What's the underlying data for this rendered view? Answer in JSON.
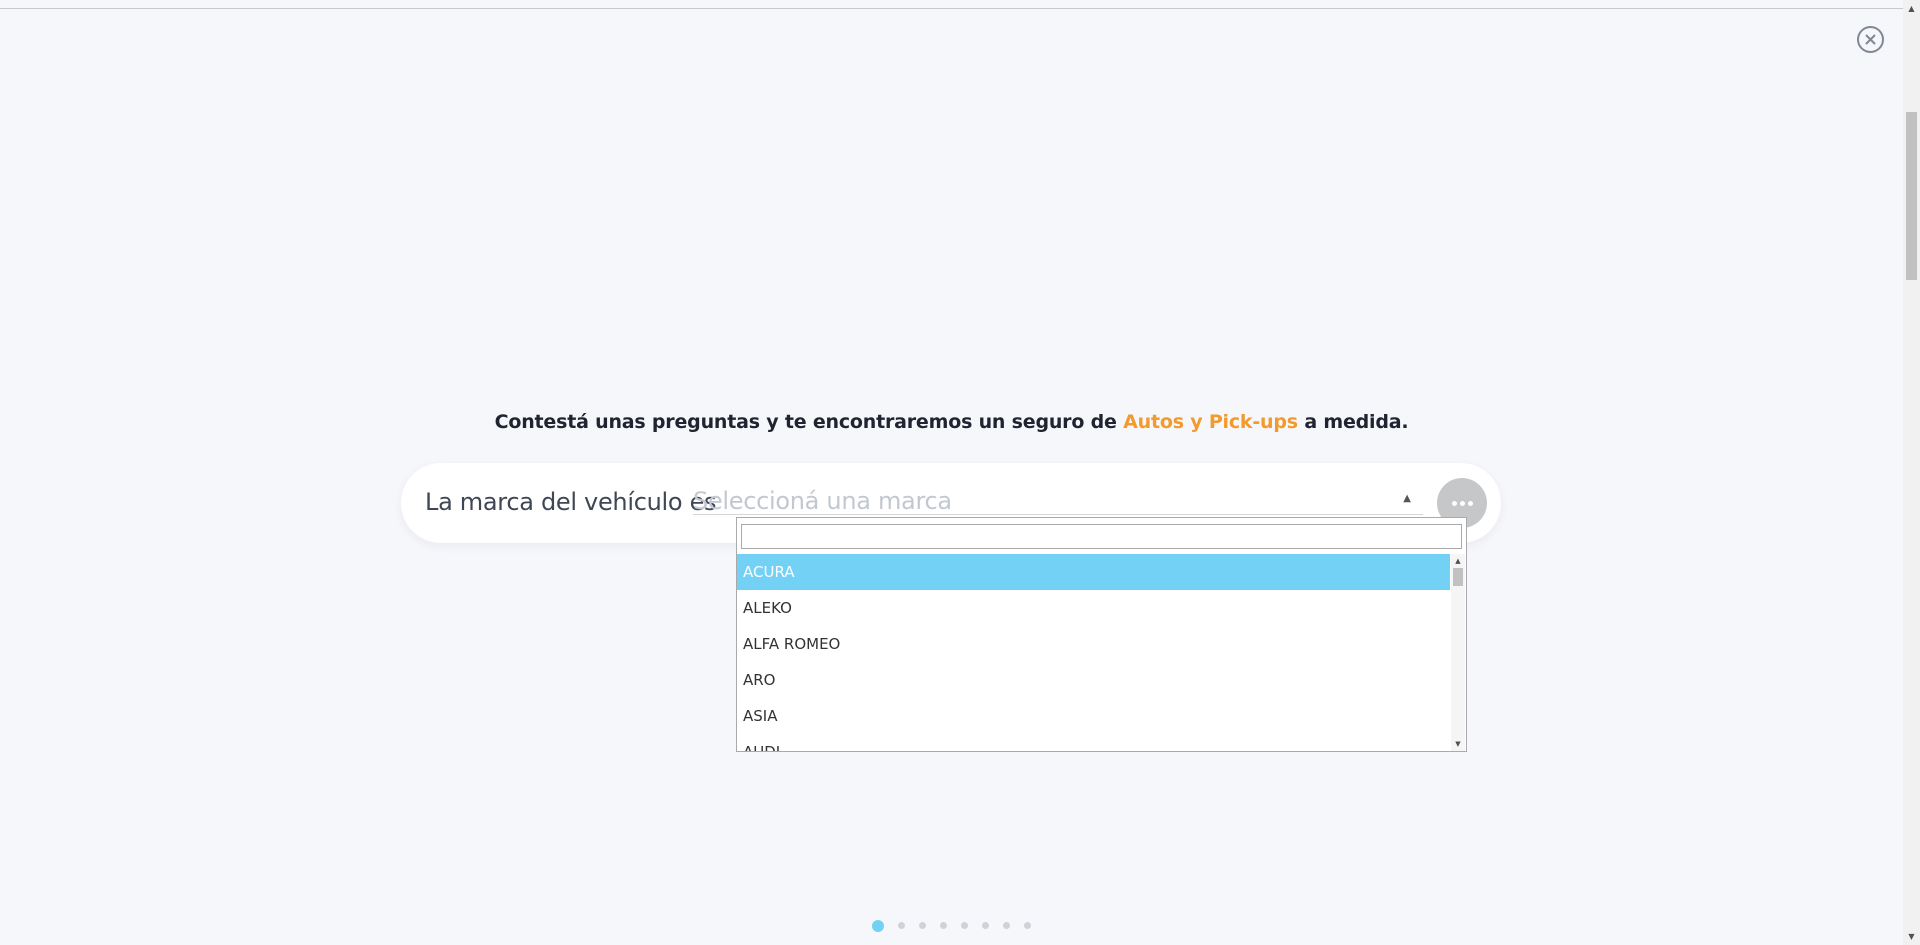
{
  "headline": {
    "prefix": "Contestá unas preguntas y te encontraremos un seguro de",
    "accent": "Autos y Pick-ups",
    "suffix": "a medida."
  },
  "question": {
    "label": "La marca del vehículo es",
    "placeholder": "Seleccioná una marca"
  },
  "dropdown": {
    "search_value": "",
    "items": [
      "ACURA",
      "ALEKO",
      "ALFA ROMEO",
      "ARO",
      "ASIA",
      "AUDI"
    ],
    "selected_index": 0
  },
  "pager": {
    "total": 8,
    "current": 1
  },
  "colors": {
    "accent": "#f29a2e",
    "highlight": "#74d1f6",
    "background": "#f6f7fb"
  },
  "icons": {
    "close": "close-icon",
    "more": "ellipsis-icon",
    "caret": "caret-up-icon"
  }
}
